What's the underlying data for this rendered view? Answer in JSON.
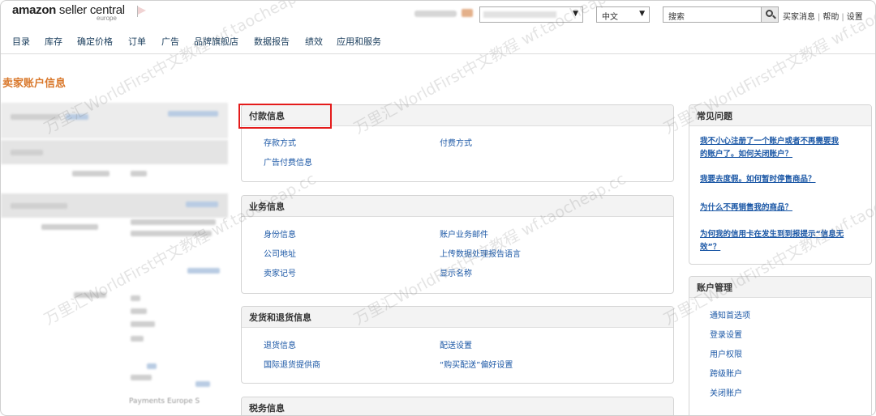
{
  "header": {
    "logo_main": "amazon",
    "logo_rest": " seller central",
    "logo_region": "europe",
    "language": "中文",
    "search_placeholder": "搜索",
    "links": [
      "买家消息",
      "帮助",
      "设置"
    ]
  },
  "nav": [
    "目录",
    "库存",
    "确定价格",
    "订单",
    "广告",
    "品牌旗舰店",
    "数据报告",
    "绩效",
    "应用和服务"
  ],
  "page_title": "卖家账户信息",
  "payment": {
    "title": "付款信息",
    "links": [
      "存款方式",
      "付费方式",
      "广告付费信息"
    ]
  },
  "business": {
    "title": "业务信息",
    "links": [
      "身份信息",
      "账户业务邮件",
      "公司地址",
      "上传数据处理报告语言",
      "卖家记号",
      "显示名称"
    ]
  },
  "shipping": {
    "title": "发货和退货信息",
    "links": [
      "退货信息",
      "配送设置",
      "国际退货提供商",
      "“购买配送”偏好设置"
    ]
  },
  "tax": {
    "title": "税务信息"
  },
  "faq": {
    "title": "常见问题",
    "links": [
      "我不小心注册了一个账户或者不再需要我的账户了。如何关闭账户？",
      "我要去度假。如何暂时停售商品？",
      "为什么不再销售我的商品？",
      "为何我的信用卡在发生到到报提示“信息无效”？"
    ]
  },
  "account_mgmt": {
    "title": "账户管理",
    "links": [
      "通知首选项",
      "登录设置",
      "用户权限",
      "跨级账户",
      "关闭账户"
    ]
  },
  "left_column": {
    "visible_text": "Payments Europe S"
  },
  "watermark": "万里汇WorldFirst中文教程 wf.taocheap.cc",
  "colors": {
    "title_orange": "#d9772a",
    "link_blue": "#1c58a6",
    "highlight_red": "#e41b1b"
  }
}
